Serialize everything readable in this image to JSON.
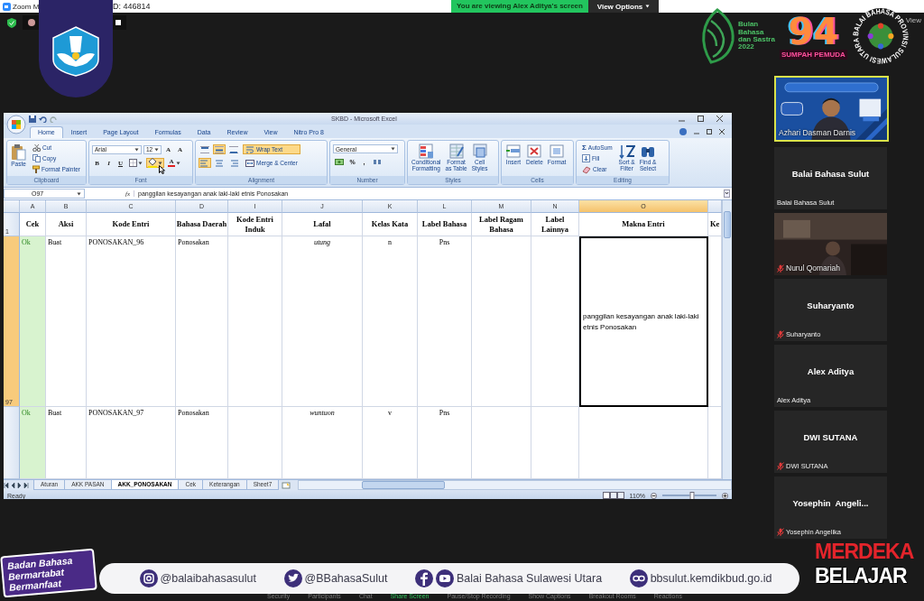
{
  "zoom": {
    "title_left": "Zoom M",
    "title_right": "D: 446814",
    "banner": "You are viewing Alex Aditya's screen",
    "view_options": "View Options",
    "view": "View"
  },
  "logos": {
    "bulan": [
      "Bulan",
      "Bahasa",
      "dan Sastra",
      "2022"
    ],
    "sumpah_number": "94",
    "sumpah": "SUMPAH PEMUDA",
    "balai_ring": "BALAI BAHASA PROVINSI SULAWESI UTARA"
  },
  "excel": {
    "title": "SKBD - Microsoft Excel",
    "tabs": [
      {
        "label": "Home",
        "selected": true
      },
      {
        "label": "Insert",
        "selected": false
      },
      {
        "label": "Page Layout",
        "selected": false
      },
      {
        "label": "Formulas",
        "selected": false
      },
      {
        "label": "Data",
        "selected": false
      },
      {
        "label": "Review",
        "selected": false
      },
      {
        "label": "View",
        "selected": false
      },
      {
        "label": "Nitro Pro 8",
        "selected": false
      }
    ],
    "ribbon": [
      {
        "kind": "clipboard",
        "label": "Clipboard",
        "big": "Paste",
        "small": [
          "Cut",
          "Copy",
          "Format Painter"
        ]
      },
      {
        "kind": "font",
        "label": "Font",
        "font": "Arial",
        "size": "12",
        "grow": "A",
        "shrink": "A",
        "styles": [
          "B",
          "I",
          "U"
        ],
        "color_button": "A"
      },
      {
        "kind": "alignment",
        "label": "Alignment",
        "vertical": [
          {
            "selected": false
          },
          {
            "selected": true
          },
          {
            "selected": false
          }
        ],
        "horizontal": [
          {
            "selected": true
          },
          {
            "selected": false
          },
          {
            "selected": false
          }
        ],
        "wrap": {
          "label": "Wrap Text",
          "selected": true
        },
        "merge": "Merge & Center"
      },
      {
        "kind": "number",
        "label": "Number",
        "format": "General",
        "symbols": [
          "%",
          ","
        ]
      },
      {
        "kind": "styles",
        "label": "Styles",
        "big": [
          [
            "Conditional",
            "Formatting"
          ],
          [
            "Format",
            "as Table"
          ],
          [
            "Cell",
            "Styles"
          ]
        ]
      },
      {
        "kind": "cells",
        "label": "Cells",
        "big": [
          [
            "Insert"
          ],
          [
            "Delete"
          ],
          [
            "Format"
          ]
        ]
      },
      {
        "kind": "editing",
        "label": "Editing",
        "sum_glyph": "Σ",
        "small": [
          "AutoSum",
          "Fill",
          "Clear"
        ],
        "big": [
          [
            "Sort &",
            "Filter"
          ],
          [
            "Find &",
            "Select"
          ]
        ]
      }
    ],
    "name_box": "O97",
    "fx": "fx",
    "formula": "panggilan kesayangan anak laki-laki etnis Ponosakan",
    "header_row_number": "1",
    "columns": [
      {
        "letter": "A",
        "heading": "Cek",
        "color": "#d8f3cf",
        "italic": false,
        "centered": false,
        "middle": false,
        "selected": false
      },
      {
        "letter": "B",
        "heading": "Aksi",
        "italic": false,
        "centered": false,
        "middle": false,
        "selected": false
      },
      {
        "letter": "C",
        "heading": "Kode Entri",
        "italic": false,
        "centered": false,
        "middle": false,
        "selected": false
      },
      {
        "letter": "D",
        "heading": "Bahasa Daerah",
        "italic": false,
        "centered": false,
        "middle": false,
        "selected": false
      },
      {
        "letter": "I",
        "heading": "Kode Entri Induk",
        "italic": false,
        "centered": false,
        "middle": false,
        "selected": false
      },
      {
        "letter": "J",
        "heading": "Lafal",
        "italic": true,
        "centered": true,
        "middle": false,
        "selected": false
      },
      {
        "letter": "K",
        "heading": "Kelas Kata",
        "italic": false,
        "centered": true,
        "middle": false,
        "selected": false
      },
      {
        "letter": "L",
        "heading": "Label Bahasa",
        "italic": false,
        "centered": true,
        "middle": false,
        "selected": false
      },
      {
        "letter": "M",
        "heading": "Label Ragam Bahasa",
        "italic": false,
        "centered": false,
        "middle": false,
        "selected": false
      },
      {
        "letter": "N",
        "heading": "Label Lainnya",
        "italic": false,
        "centered": false,
        "middle": false,
        "selected": false
      },
      {
        "letter": "O",
        "heading": "Makna Entri",
        "italic": false,
        "centered": false,
        "middle": true,
        "selected": true
      },
      {
        "heading": "Ke",
        "italic": false,
        "centered": false,
        "middle": false,
        "selected": false
      }
    ],
    "rows": [
      {
        "number": "97",
        "selected": true,
        "cells": {
          "A": "Ok",
          "B": "Buat",
          "C": "PONOSAKAN_96",
          "D": "Ponosakan",
          "J": "utung",
          "K": "n",
          "L": "Pns",
          "O": "panggilan kesayangan anak laki-laki etnis Ponosakan"
        }
      },
      {
        "selected": false,
        "cells": {
          "A": "Ok",
          "B": "Buat",
          "C": "PONOSAKAN_97",
          "D": "Ponosakan",
          "J": "wuntuon",
          "K": "v",
          "L": "Pns"
        }
      }
    ],
    "sheets": [
      {
        "label": "Aturan",
        "selected": false
      },
      {
        "label": "AKK PASAN",
        "selected": false
      },
      {
        "label": "AKK_PONOSAKAN",
        "selected": true
      },
      {
        "label": "Cek",
        "selected": false
      },
      {
        "label": "Keterangan",
        "selected": false
      },
      {
        "label": "Sheet7",
        "selected": false
      }
    ],
    "status": "Ready",
    "zoom": {
      "reading": "110%",
      "level": 0.55
    }
  },
  "participants": [
    {
      "kind": "video",
      "label": "Azhari Dasman Darnis",
      "speaking": true,
      "muted": false
    },
    {
      "kind": "name",
      "name": "Balai Bahasa Sulut",
      "label": "Balai Bahasa Sulut",
      "speaking": false,
      "muted": false
    },
    {
      "kind": "video",
      "label": "Nurul Qomariah",
      "speaking": false,
      "muted": true
    },
    {
      "kind": "name",
      "name": "Suharyanto",
      "label": "Suharyanto",
      "speaking": false,
      "muted": true
    },
    {
      "kind": "name",
      "name": "Alex Aditya",
      "label": "Alex Aditya",
      "speaking": false,
      "muted": false
    },
    {
      "kind": "name",
      "name": "DWI SUTANA",
      "label": "DWI SUTANA",
      "speaking": false,
      "muted": true
    },
    {
      "kind": "name",
      "name": "Yosephin  Angeli...",
      "label": "Yosephin Angelika",
      "speaking": false,
      "muted": true
    }
  ],
  "footer": {
    "badge": [
      "Badan Bahasa",
      "Bermartabat",
      "Bermanfaat"
    ],
    "links": [
      {
        "kind": "instagram",
        "text": "@balaibahasasulut"
      },
      {
        "kind": "twitter",
        "text": "@BBahasaSulut"
      },
      {
        "kind": "facebook_youtube",
        "text": "Balai Bahasa Sulawesi Utara"
      },
      {
        "kind": "web",
        "text": "bbsulut.kemdikbud.go.id"
      }
    ],
    "merdeka": [
      "MERDEKA",
      "BELAJAR"
    ],
    "toolbar": [
      {
        "label": "Security",
        "active": false
      },
      {
        "label": "Participants",
        "active": false
      },
      {
        "label": "Chat",
        "active": false
      },
      {
        "label": "Share Screen",
        "active": true
      },
      {
        "label": "Pause/Stop Recording",
        "active": false
      },
      {
        "label": "Show Captions",
        "active": false
      },
      {
        "label": "Breakout Rooms",
        "active": false
      },
      {
        "label": "Reactions",
        "active": false
      }
    ]
  }
}
